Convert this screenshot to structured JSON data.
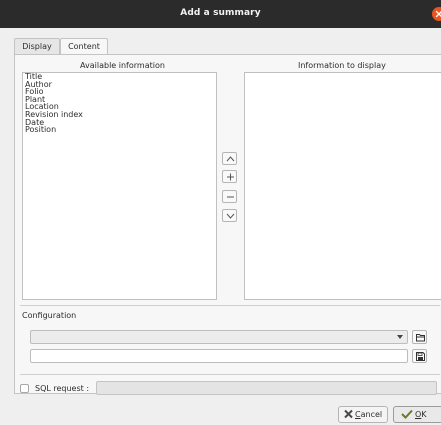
{
  "window": {
    "title": "Add a summary"
  },
  "tabs": [
    {
      "label": "Display",
      "active": false
    },
    {
      "label": "Content",
      "active": true
    }
  ],
  "available": {
    "label": "Available information",
    "items": [
      "Title",
      "Author",
      "Folio",
      "Plant",
      "Location",
      "Revision index",
      "Date",
      "Position"
    ]
  },
  "display": {
    "label": "Information to display",
    "items": []
  },
  "arrows": [
    "chevron-up-icon",
    "plus-icon",
    "minus-icon",
    "chevron-down-icon"
  ],
  "configuration": {
    "label": "Configuration",
    "combo_value": "",
    "text_value": ""
  },
  "sql": {
    "label": "SQL request  :",
    "checked": false,
    "value": ""
  },
  "buttons": {
    "cancel": "Cancel",
    "ok": "OK"
  },
  "colors": {
    "titlebar": "#2b2b2b",
    "close": "#e95420",
    "window_bg": "#efefef"
  }
}
